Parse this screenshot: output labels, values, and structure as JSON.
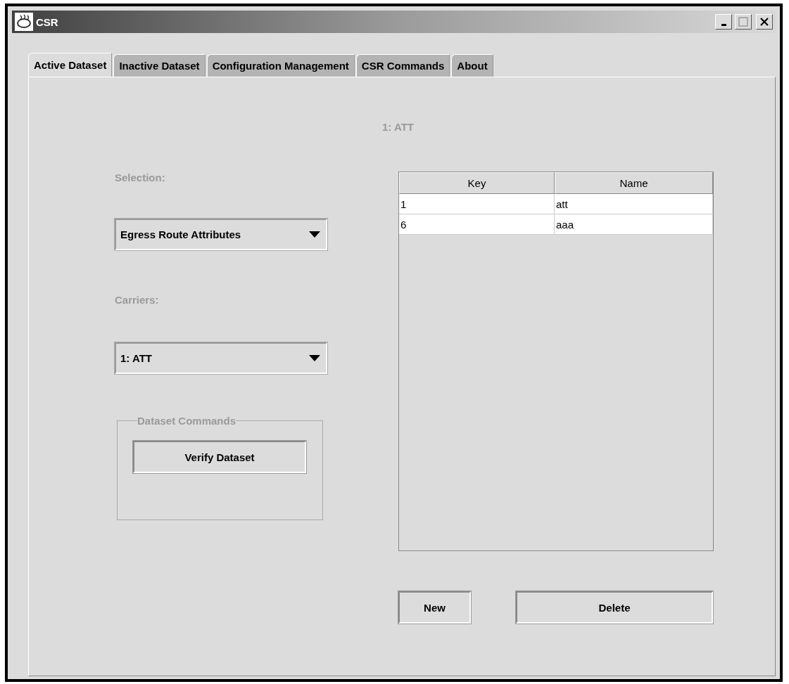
{
  "window": {
    "title": "CSR"
  },
  "tabs": [
    {
      "label": "Active Dataset",
      "selected": true
    },
    {
      "label": "Inactive Dataset",
      "selected": false
    },
    {
      "label": "Configuration Management",
      "selected": false
    },
    {
      "label": "CSR Commands",
      "selected": false
    },
    {
      "label": "About",
      "selected": false
    }
  ],
  "header": "1: ATT",
  "selection": {
    "label": "Selection:",
    "value": "Egress Route Attributes"
  },
  "carriers": {
    "label": "Carriers:",
    "value": "1: ATT"
  },
  "dataset_commands": {
    "title": "Dataset Commands",
    "buttons": [
      "Verify Dataset"
    ]
  },
  "table": {
    "columns": [
      "Key",
      "Name"
    ],
    "rows": [
      [
        "1",
        "att"
      ],
      [
        "6",
        "aaa"
      ]
    ]
  },
  "buttons": [
    "New",
    "Delete"
  ]
}
